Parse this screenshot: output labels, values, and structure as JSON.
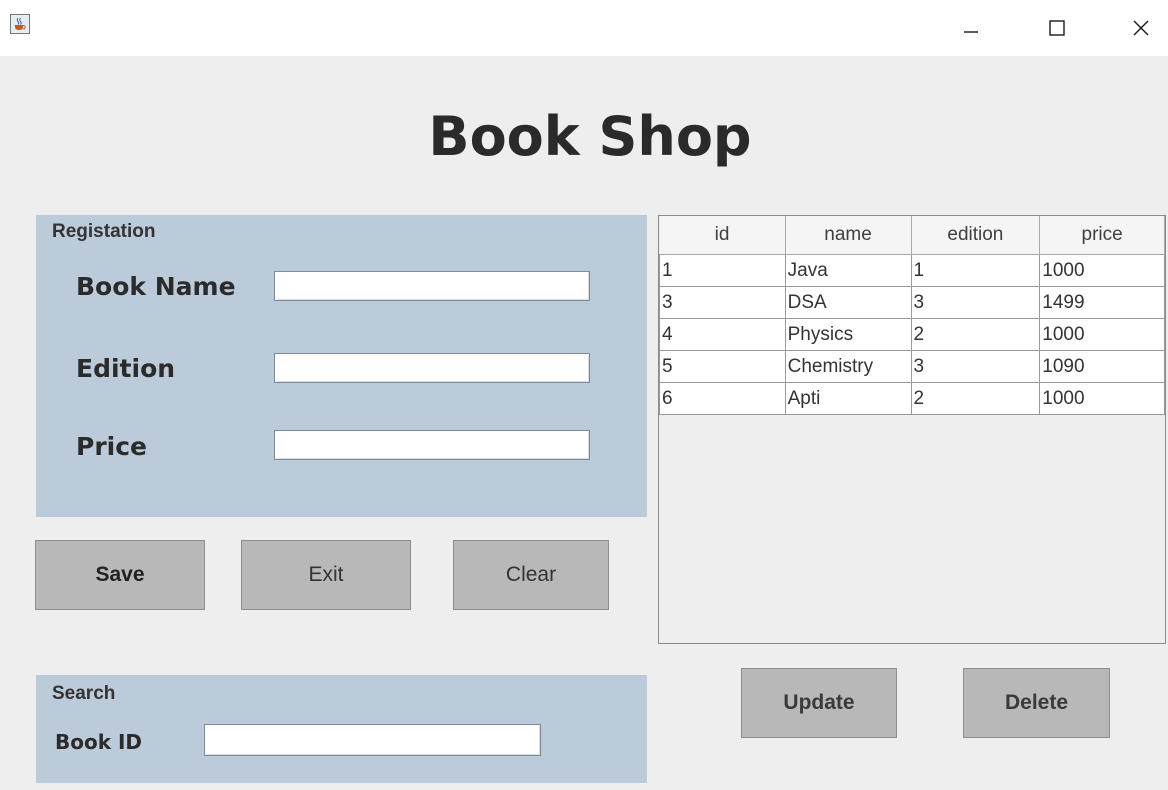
{
  "window": {
    "title_icon": "java-cup-icon",
    "controls": [
      "minimize-icon",
      "maximize-icon",
      "close-icon"
    ]
  },
  "header": {
    "title": "Book Shop"
  },
  "registration": {
    "title": "Registation",
    "book_name_label": "Book Name",
    "book_name_value": "",
    "edition_label": "Edition",
    "edition_value": "",
    "price_label": "Price",
    "price_value": ""
  },
  "actions": {
    "save": "Save",
    "exit": "Exit",
    "clear": "Clear",
    "update": "Update",
    "delete": "Delete"
  },
  "search": {
    "title": "Search",
    "book_id_label": "Book ID",
    "book_id_value": ""
  },
  "table": {
    "columns": [
      "id",
      "name",
      "edition",
      "price"
    ],
    "rows": [
      [
        "1",
        "Java",
        "1",
        "1000"
      ],
      [
        "3",
        "DSA",
        "3",
        "1499"
      ],
      [
        "4",
        "Physics",
        "2",
        "1000"
      ],
      [
        "5",
        "Chemistry",
        "3",
        "1090"
      ],
      [
        "6",
        "Apti",
        "2",
        "1000"
      ]
    ]
  },
  "colors": {
    "panel": "#bccbd9",
    "button": "#b8b8b8",
    "background": "#eeeeee"
  }
}
